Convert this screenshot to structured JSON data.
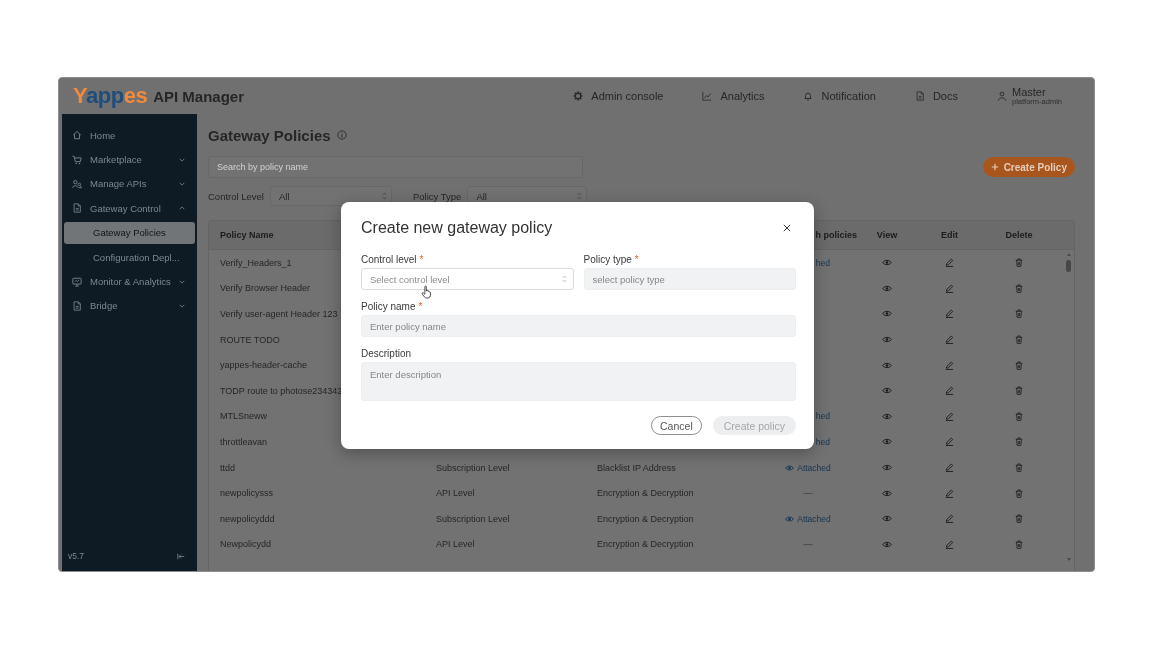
{
  "header": {
    "logo": "Yappes",
    "app_name": "API Manager",
    "nav": [
      {
        "label": "Admin console"
      },
      {
        "label": "Analytics"
      },
      {
        "label": "Notification"
      },
      {
        "label": "Docs"
      }
    ],
    "user": {
      "name": "Master",
      "role": "platform-admin"
    }
  },
  "sidebar": {
    "items": [
      {
        "label": "Home",
        "kind": "link",
        "selected": false
      },
      {
        "label": "Marketplace",
        "kind": "group",
        "expanded": false,
        "selected": false
      },
      {
        "label": "Manage APIs",
        "kind": "group",
        "expanded": false,
        "selected": false
      },
      {
        "label": "Gateway Control",
        "kind": "group",
        "expanded": true,
        "selected": false,
        "children": [
          {
            "label": "Gateway Policies",
            "selected": true
          },
          {
            "label": "Configuration Depl...",
            "selected": false
          }
        ]
      },
      {
        "label": "Monitor & Analytics",
        "kind": "group",
        "expanded": false,
        "selected": false
      },
      {
        "label": "Bridge",
        "kind": "group",
        "expanded": false,
        "selected": false
      }
    ],
    "version": "v5.7"
  },
  "page": {
    "title": "Gateway Policies",
    "search": {
      "placeholder": "Search by policy name"
    },
    "create_button": "Create Policy",
    "filters": [
      {
        "label": "Control Level",
        "value": "All"
      },
      {
        "label": "Policy Type",
        "value": "All"
      }
    ]
  },
  "table": {
    "columns": {
      "policy_name": "Policy Name",
      "attach": "h policies",
      "view": "View",
      "edit": "Edit",
      "delete": "Delete"
    },
    "rows": [
      {
        "policy_name": "Verify_Headers_1",
        "attach": {
          "kind": "clipped",
          "text": "hed"
        }
      },
      {
        "policy_name": "Verify Browser Header"
      },
      {
        "policy_name": "Verify user-agent Header 123"
      },
      {
        "policy_name": "ROUTE TODO"
      },
      {
        "policy_name": "yappes-header-cache"
      },
      {
        "policy_name": "TODP route to photose234342"
      },
      {
        "policy_name": "MTLSneww",
        "attach": {
          "kind": "clipped",
          "text": "hed"
        }
      },
      {
        "policy_name": "throttleavan",
        "attach": {
          "kind": "clipped",
          "text": "hed"
        }
      },
      {
        "policy_name": "ttdd",
        "control_level": "Subscription Level",
        "policy_type": "Blacklist IP Address",
        "attach": {
          "kind": "attached",
          "text": "Attached"
        }
      },
      {
        "policy_name": "newpolicysss",
        "control_level": "API Level",
        "policy_type": "Encryption & Decryption",
        "attach": {
          "kind": "none",
          "text": "—"
        }
      },
      {
        "policy_name": "newpolicyddd",
        "control_level": "Subscription Level",
        "policy_type": "Encryption & Decryption",
        "attach": {
          "kind": "attached",
          "text": "Attached"
        }
      },
      {
        "policy_name": "Newpolicydd",
        "control_level": "API Level",
        "policy_type": "Encryption & Decryption",
        "attach": {
          "kind": "none",
          "text": "—"
        }
      }
    ]
  },
  "modal": {
    "title": "Create new gateway policy",
    "fields": [
      {
        "label": "Control level",
        "required_mark": "*",
        "kind": "select",
        "placeholder": "Select control level"
      },
      {
        "label": "Policy type",
        "required_mark": "*",
        "kind": "input",
        "placeholder": "select policy type"
      },
      {
        "label": "Policy name",
        "required_mark": "*",
        "kind": "input",
        "placeholder": "Enter policy name"
      },
      {
        "label": "Description",
        "kind": "textarea",
        "placeholder": "Enter description"
      }
    ],
    "buttons": [
      {
        "label": "Cancel",
        "kind": "secondary",
        "disabled": false
      },
      {
        "label": "Create policy",
        "kind": "primary",
        "disabled": true
      }
    ]
  }
}
